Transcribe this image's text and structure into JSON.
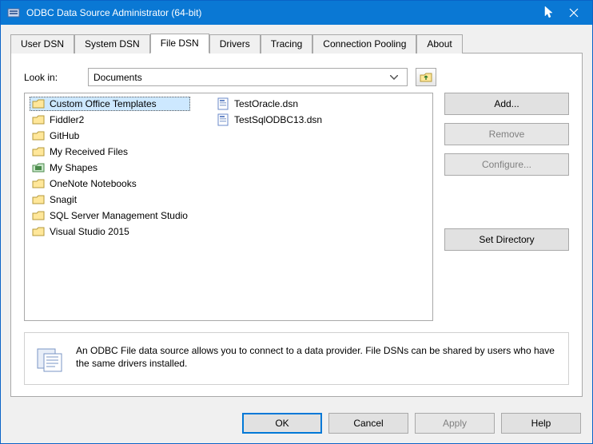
{
  "titlebar": {
    "title": "ODBC Data Source Administrator (64-bit)"
  },
  "tabs": [
    {
      "label": "User DSN"
    },
    {
      "label": "System DSN"
    },
    {
      "label": "File DSN"
    },
    {
      "label": "Drivers"
    },
    {
      "label": "Tracing"
    },
    {
      "label": "Connection Pooling"
    },
    {
      "label": "About"
    }
  ],
  "active_tab_index": 2,
  "lookin": {
    "label": "Look in:",
    "value": "Documents"
  },
  "folders": [
    "Custom Office Templates",
    "Fiddler2",
    "GitHub",
    "My Received Files",
    "My Shapes",
    "OneNote Notebooks",
    "Snagit",
    "SQL Server Management Studio",
    "Visual Studio 2015"
  ],
  "files": [
    "TestOracle.dsn",
    "TestSqlODBC13.dsn"
  ],
  "sidebuttons": {
    "add": "Add...",
    "remove": "Remove",
    "configure": "Configure...",
    "setdir": "Set Directory"
  },
  "info": "An ODBC File data source allows you to connect to a data provider.  File DSNs can be shared by users who have the same drivers installed.",
  "footer": {
    "ok": "OK",
    "cancel": "Cancel",
    "apply": "Apply",
    "help": "Help"
  }
}
